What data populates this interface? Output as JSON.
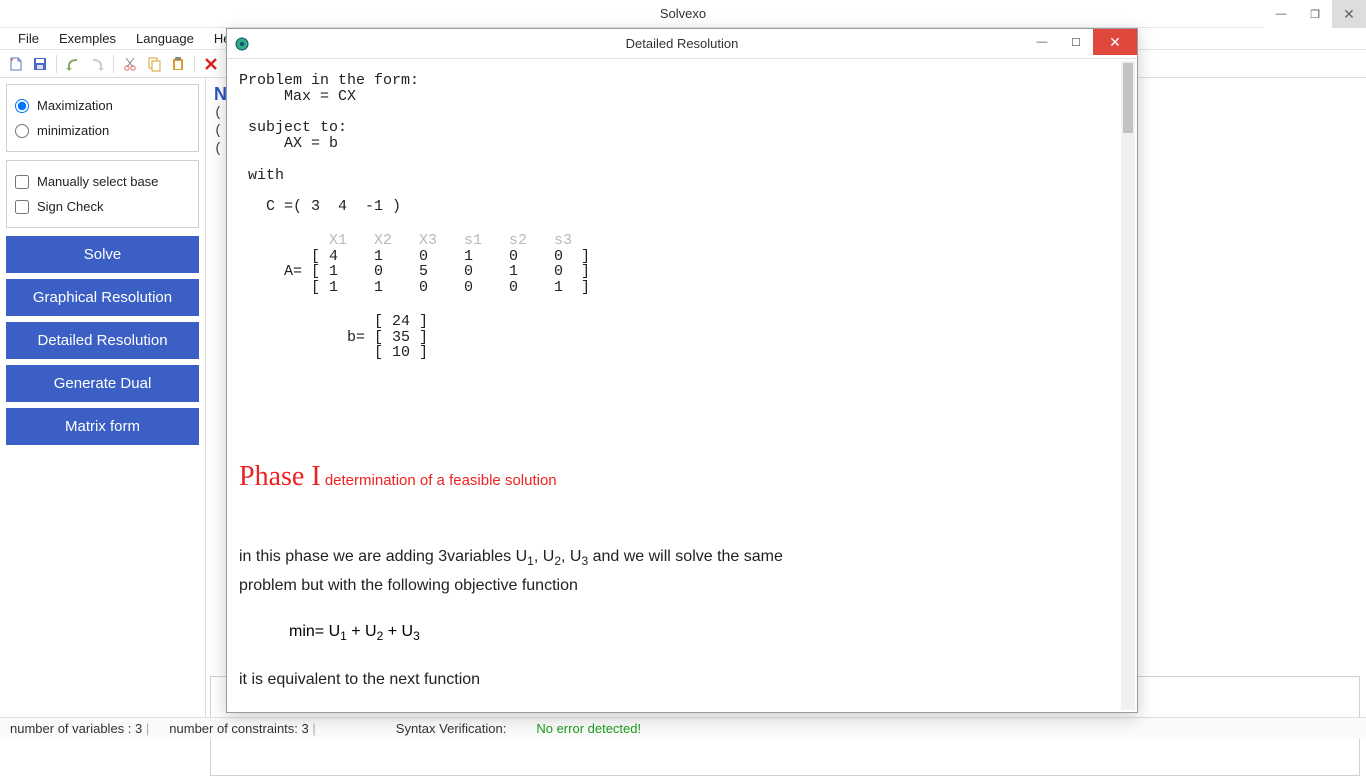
{
  "main_window": {
    "title": "Solvexo",
    "controls": {
      "minimize": "—",
      "maximize": "❐",
      "close": "✕"
    }
  },
  "menubar": [
    "File",
    "Exemples",
    "Language",
    "Help"
  ],
  "toolbar_icons": [
    "new",
    "save",
    "undo",
    "redo",
    "cut",
    "copy",
    "paste",
    "delete",
    "run"
  ],
  "sidebar": {
    "opt_type": {
      "maximization": "Maximization",
      "minimization": "minimization",
      "selected": "maximization"
    },
    "checks": {
      "manual_base": "Manually select base",
      "sign_check": "Sign Check"
    },
    "buttons": {
      "solve": "Solve",
      "graphical": "Graphical Resolution",
      "detailed": "Detailed Resolution",
      "dual": "Generate Dual",
      "matrix": "Matrix form"
    }
  },
  "dialog": {
    "title": "Detailed Resolution",
    "controls": {
      "minimize": "—",
      "maximize": "☐",
      "close": "✕"
    },
    "problem_block": "Problem in the form:\n     Max = CX\n\n subject to:\n     AX = b\n\n with\n\n   C =( 3  4  -1 )",
    "col_headers": "          X1   X2   X3   s1   s2   s3",
    "matrix_a": "        [ 4    1    0    1    0    0  ]\n     A= [ 1    0    5    0    1    0  ]\n        [ 1    1    0    0    0    1  ]",
    "matrix_b": "               [ 24 ]\n            b= [ 35 ]\n               [ 10 ]",
    "phase_title_big": "Phase I",
    "phase_title_small": "determination of a feasible solution",
    "phase_text_1a": " in this phase we are adding 3variables  U",
    "phase_text_1b": ", U",
    "phase_text_1c": ", U",
    "phase_text_1d": " and we will solve the same",
    "phase_text_2": "problem but with the following objective function",
    "objective": {
      "prefix": "min= U",
      "plus": " + U"
    },
    "truncated": "it is equivalent to the next function"
  },
  "statusbar": {
    "vars_label": "number of variables :",
    "vars_value": "3",
    "cons_label": "number of constraints:",
    "cons_value": "3",
    "syntax_label": "Syntax Verification:",
    "syntax_ok": "No error detected!"
  }
}
